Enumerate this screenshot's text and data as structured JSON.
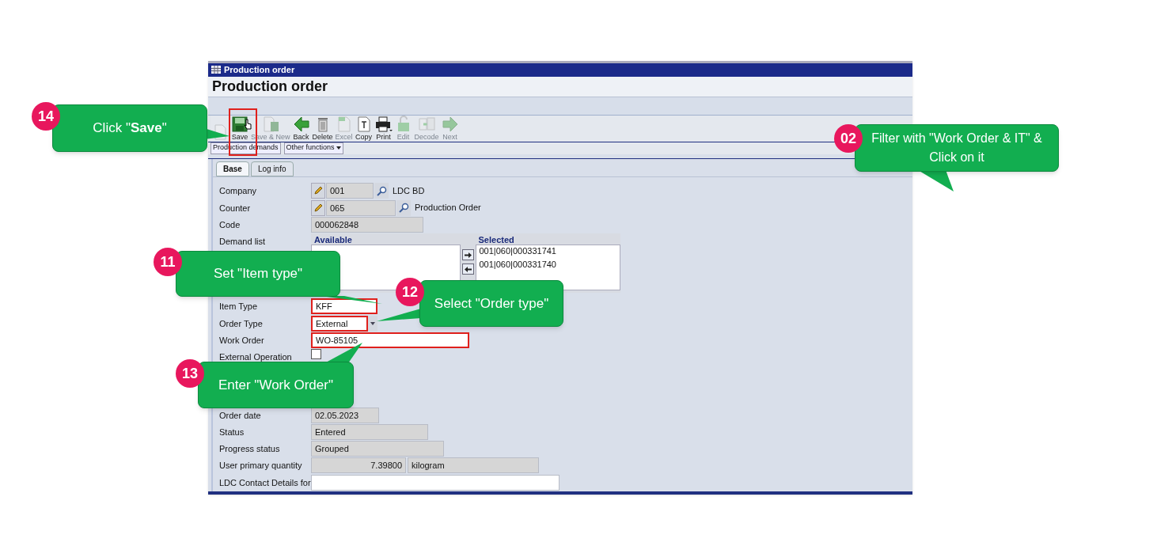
{
  "window": {
    "title": "Production order"
  },
  "header": {
    "title": "Production order"
  },
  "toolbar": {
    "buttons": [
      {
        "kind": "new",
        "disabled": true
      },
      {
        "kind": "save",
        "label": "Save",
        "disabled": false
      },
      {
        "kind": "save_new",
        "label": "Save & New",
        "disabled": true
      },
      {
        "kind": "back",
        "label": "Back",
        "disabled": false
      },
      {
        "kind": "delete",
        "label": "Delete",
        "disabled": false
      },
      {
        "kind": "excel",
        "label": "Excel",
        "disabled": true
      },
      {
        "kind": "copy",
        "label": "Copy",
        "disabled": false
      },
      {
        "kind": "print",
        "label": "Print",
        "disabled": false
      },
      {
        "kind": "edit",
        "label": "Edit",
        "disabled": true
      },
      {
        "kind": "decode",
        "label": "Decode",
        "disabled": true
      },
      {
        "kind": "next",
        "label": "Next",
        "disabled": true
      }
    ]
  },
  "subbar": [
    {
      "label": "Production demands",
      "dropdown": false
    },
    {
      "label": "Other functions",
      "dropdown": true
    }
  ],
  "tabs": [
    {
      "label": "Base",
      "selected": true
    },
    {
      "label": "Log info",
      "selected": false
    }
  ],
  "form_top": [
    {
      "kind": "lookup",
      "label": "Company",
      "value": "001",
      "description": "LDC BD"
    },
    {
      "kind": "lookup",
      "label": "Counter",
      "value": "065",
      "description": "Production Order"
    },
    {
      "kind": "readonly",
      "label": "Code",
      "value": "000062848"
    },
    {
      "kind": "list",
      "label": "Demand list",
      "available_title": "Available",
      "selected_title": "Selected",
      "selected_items": [
        "001|060|000331741",
        "001|060|000331740"
      ]
    },
    {
      "kind": "input",
      "label": "Item Type",
      "value": "KFF",
      "highlighted": true
    },
    {
      "kind": "select",
      "label": "Order Type",
      "value": "External",
      "highlighted": true
    },
    {
      "kind": "input",
      "label": "Work Order",
      "value": "WO-85105",
      "highlighted": true
    },
    {
      "kind": "checkbox",
      "label": "External Operation",
      "checked": false
    }
  ],
  "form_bottom": [
    {
      "kind": "readonly",
      "label": "Order date",
      "value": "02.05.2023"
    },
    {
      "kind": "readonly",
      "label": "Status",
      "value": "Entered"
    },
    {
      "kind": "readonly",
      "label": "Progress status",
      "value": "Grouped"
    },
    {
      "kind": "quantity",
      "label": "User primary quantity",
      "value": "7.39800",
      "unit": "kilogram"
    },
    {
      "kind": "input",
      "label": "LDC Contact Details for",
      "highlighted": false
    }
  ],
  "callouts": [
    {
      "number": "14",
      "text": "Click \"**Save**\""
    },
    {
      "number": "02",
      "text": "Filter with \"Work Order & IT\" & Click on it"
    },
    {
      "number": "11",
      "text": "Set \"Item type\""
    },
    {
      "number": "12",
      "text": "Select \"Order type\""
    },
    {
      "number": "13",
      "text": "Enter \"Work Order\""
    }
  ]
}
